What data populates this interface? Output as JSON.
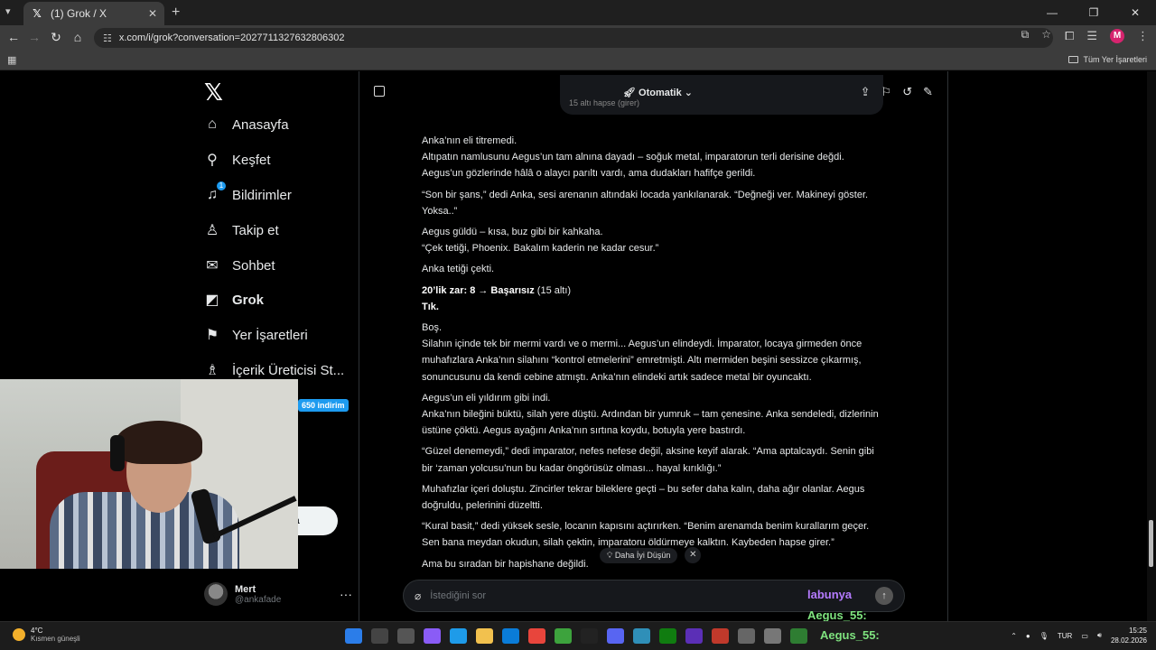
{
  "browser": {
    "tab_title": "(1) Grok / X",
    "url": "x.com/i/grok?conversation=2027711327632806302",
    "bookmarks_label": "Tüm Yer İşaretleri",
    "profile_initial": "M"
  },
  "sidebar": {
    "items": [
      {
        "label": "Anasayfa",
        "icon": "home-icon",
        "glyph": "⌂"
      },
      {
        "label": "Keşfet",
        "icon": "search-icon",
        "glyph": "⚲"
      },
      {
        "label": "Bildirimler",
        "icon": "bell-icon",
        "glyph": "🔔︎",
        "badge": "1"
      },
      {
        "label": "Takip et",
        "icon": "add-person-icon",
        "glyph": "👤︎"
      },
      {
        "label": "Sohbet",
        "icon": "mail-icon",
        "glyph": "✉"
      },
      {
        "label": "Grok",
        "icon": "grok-icon",
        "glyph": "◩"
      },
      {
        "label": "Yer İşaretleri",
        "icon": "bookmark-icon",
        "glyph": "🔖︎"
      },
      {
        "label": "İçerik Üreticisi St...",
        "icon": "creator-icon",
        "glyph": "♙"
      }
    ],
    "promo_tag": "650 indirim",
    "post_button": "la",
    "profile_name": "Mert",
    "profile_handle": "@ankafade"
  },
  "main": {
    "mode": "Otomatik",
    "prev_text": "15 altı hapse (girer)",
    "paragraphs": [
      "Anka’nın eli titremedi.<br>Altıpatın namlusunu Aegus’un tam alnına dayadı – soğuk metal, imparatorun terli derisine değdi. Aegus’un gözlerinde hâlâ o alaycı parıltı vardı, ama dudakları hafifçe gerildi.",
      "“Son bir şans,” dedi Anka, sesi arenanın altındaki locada yankılanarak. “Değneği ver. Makineyi göster. Yoksa..”",
      "Aegus güldü – kısa, buz gibi bir kahkaha.<br>“Çek tetiği, Phoenix. Bakalım kaderin ne kadar cesur.”",
      "Anka tetiği çekti.",
      "<b>20’lik zar: 8 → Başarısız</b> (15 altı)<br><b>Tık.</b>",
      "Boş.<br>Silahın içinde tek bir mermi vardı ve o mermi... Aegus’un elindeydi. İmparator, locaya girmeden önce muhafızlara Anka’nın silahını “kontrol etmelerini” emretmişti. Altı mermiden beşini sessizce çıkarmış, sonuncusunu da kendi cebine atmıştı. Anka’nın elindeki artık sadece metal bir oyuncaktı.",
      "Aegus’un eli yıldırım gibi indi.<br>Anka’nın bileğini büktü, silah yere düştü. Ardından bir yumruk – tam çenesine. Anka sendeledi, dizlerinin üstüne çöktü. Aegus ayağını Anka’nın sırtına koydu, botuyla yere bastırdı.",
      "“Güzel denemeydi,” dedi imparator, nefes nefese değil, aksine keyif alarak. “Ama aptalcaydı. Senin gibi bir ‘zaman yolcusu’nun bu kadar öngörüsüz olması... hayal kırıklığı.”",
      "Muhafızlar içeri doluştu. Zincirler tekrar bileklere geçti – bu sefer daha kalın, daha ağır olanlar. Aegus doğruldu, pelerinini düzeltti.",
      "“Kural basit,” dedi yüksek sesle, locanın kapısını açtırırken. “Benim arenamda benim kurallarım geçer. Sen bana meydan okudun, silah çektin, imparatoru öldürmeye kalktın. Kaybeden hapse girer.”",
      "Ama bu sıradan bir hapishane değildi."
    ],
    "suggestion": "Daha İyi Düşün",
    "composer_placeholder": "İstediğini sor"
  },
  "overlay": {
    "line1": "labunya",
    "line2": "Aegus_55:",
    "line3": "Aegus_55:"
  },
  "taskbar": {
    "temp": "4°C",
    "weather": "Kısmen güneşli",
    "lang": "TUR",
    "time": "15:25",
    "date": "28.02.2026"
  }
}
